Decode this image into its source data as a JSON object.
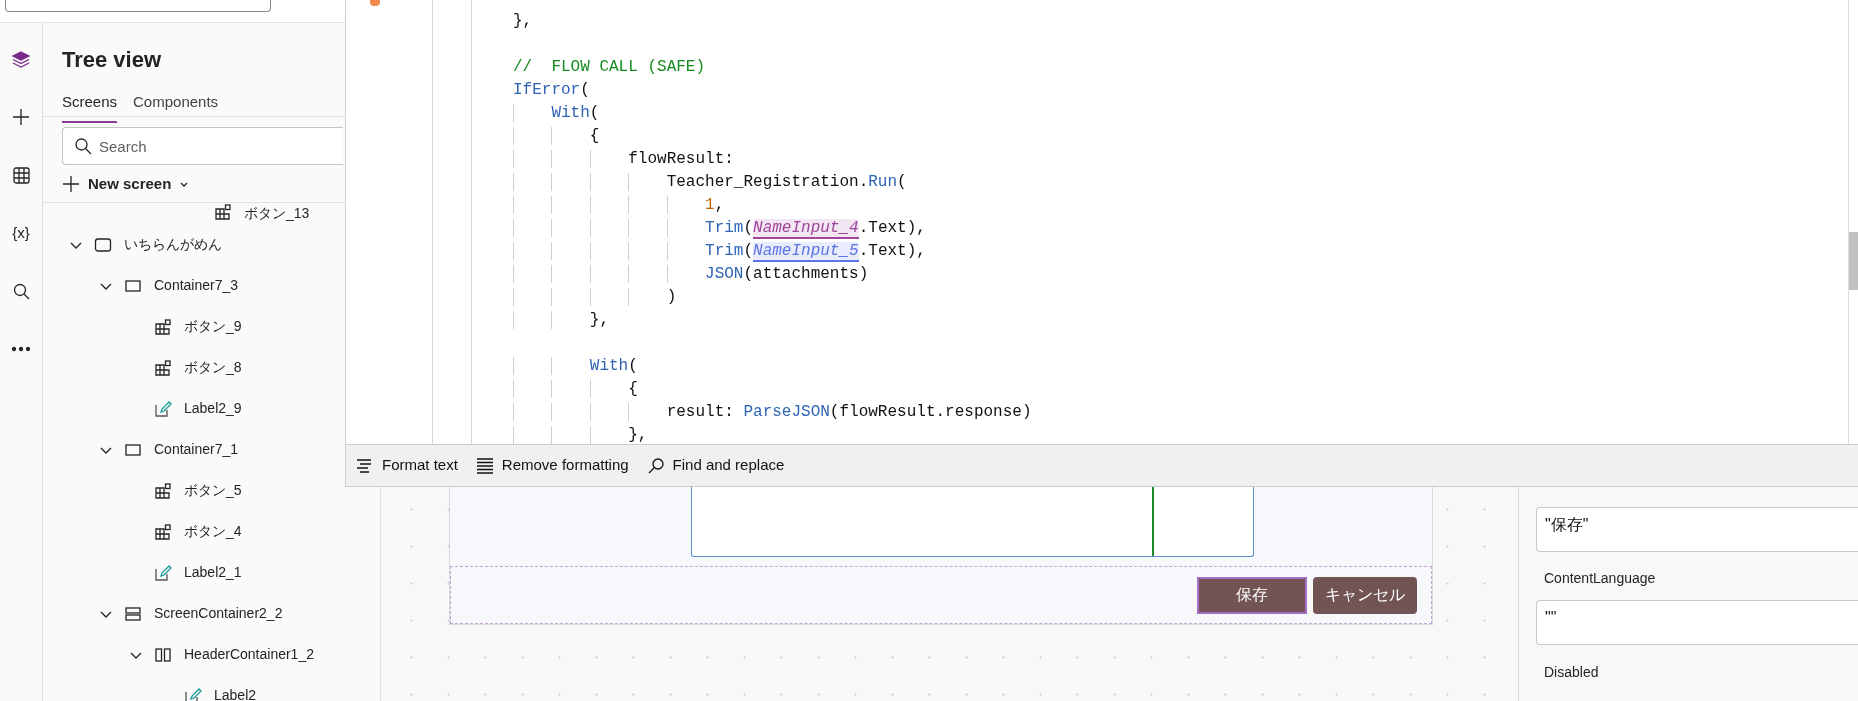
{
  "rail": [
    {
      "kind": "layers",
      "selected": true
    },
    {
      "kind": "insert",
      "selected": false
    },
    {
      "kind": "data",
      "selected": false
    },
    {
      "kind": "variables",
      "glyph": "{x}",
      "selected": false
    },
    {
      "kind": "search",
      "selected": false
    },
    {
      "kind": "more",
      "selected": false
    }
  ],
  "tree_view": {
    "title": "Tree view",
    "tabs": [
      {
        "label": "Screens",
        "selected": true
      },
      {
        "label": "Components",
        "selected": false
      }
    ],
    "search": {
      "placeholder": "Search"
    },
    "new_screen": "New screen",
    "partial_item": {
      "label": "ボタン_13",
      "kind": "button"
    },
    "items": [
      {
        "label": "いちらんがめん",
        "kind": "screen",
        "expanded": true,
        "children": [
          {
            "label": "Container7_3",
            "kind": "container",
            "expanded": true,
            "children": [
              {
                "label": "ボタン_9",
                "kind": "button"
              },
              {
                "label": "ボタン_8",
                "kind": "button"
              },
              {
                "label": "Label2_9",
                "kind": "label"
              }
            ]
          },
          {
            "label": "Container7_1",
            "kind": "container",
            "expanded": true,
            "children": [
              {
                "label": "ボタン_5",
                "kind": "button"
              },
              {
                "label": "ボタン_4",
                "kind": "button"
              },
              {
                "label": "Label2_1",
                "kind": "label"
              }
            ]
          },
          {
            "label": "ScreenContainer2_2",
            "kind": "vertical-container",
            "expanded": true,
            "children": [
              {
                "label": "HeaderContainer1_2",
                "kind": "horizontal-container",
                "expanded": true,
                "children": [
                  {
                    "label": "Label2",
                    "kind": "label"
                  }
                ]
              }
            ]
          }
        ]
      }
    ]
  },
  "formula_editor": {
    "code_lines": [
      {
        "tokens": [
          {
            "text": "},",
            "kind": "plain"
          }
        ]
      },
      {
        "kind": "blank"
      },
      {
        "tokens": [
          {
            "text": "//  FLOW CALL (SAFE)",
            "kind": "comment"
          }
        ]
      },
      {
        "tokens": [
          {
            "text": "IfError",
            "kind": "function"
          },
          {
            "text": "(",
            "kind": "plain"
          }
        ]
      },
      {
        "tokens": [
          {
            "text": "    With",
            "kind": "function"
          },
          {
            "text": "(",
            "kind": "plain"
          }
        ]
      },
      {
        "tokens": [
          {
            "text": "        {",
            "kind": "plain"
          }
        ]
      },
      {
        "tokens": [
          {
            "text": "            flowResult:",
            "kind": "plain"
          }
        ]
      },
      {
        "tokens": [
          {
            "text": "                Teacher_Registration.",
            "kind": "plain"
          },
          {
            "text": "Run",
            "kind": "function"
          },
          {
            "text": "(",
            "kind": "plain"
          }
        ]
      },
      {
        "tokens": [
          {
            "text": "                    1",
            "kind": "number"
          },
          {
            "text": ",",
            "kind": "plain"
          }
        ]
      },
      {
        "tokens": [
          {
            "text": "                    Trim",
            "kind": "function"
          },
          {
            "text": "(",
            "kind": "plain"
          },
          {
            "text": "NameInput_4",
            "kind": "reference",
            "color": "#a0449c"
          },
          {
            "text": ".Text),",
            "kind": "plain"
          }
        ]
      },
      {
        "tokens": [
          {
            "text": "                    Trim",
            "kind": "function"
          },
          {
            "text": "(",
            "kind": "plain"
          },
          {
            "text": "NameInput_5",
            "kind": "reference",
            "color": "#5b74e6"
          },
          {
            "text": ".Text),",
            "kind": "plain"
          }
        ]
      },
      {
        "tokens": [
          {
            "text": "                    JSON",
            "kind": "function"
          },
          {
            "text": "(attachments)",
            "kind": "plain"
          }
        ]
      },
      {
        "tokens": [
          {
            "text": "                )",
            "kind": "plain"
          }
        ]
      },
      {
        "tokens": [
          {
            "text": "        },",
            "kind": "plain"
          }
        ]
      },
      {
        "kind": "blank"
      },
      {
        "tokens": [
          {
            "text": "        With",
            "kind": "function"
          },
          {
            "text": "(",
            "kind": "plain"
          }
        ]
      },
      {
        "tokens": [
          {
            "text": "            {",
            "kind": "plain"
          }
        ]
      },
      {
        "tokens": [
          {
            "text": "                result: ",
            "kind": "plain"
          },
          {
            "text": "ParseJSON",
            "kind": "function"
          },
          {
            "text": "(flowResult.response)",
            "kind": "plain"
          }
        ]
      },
      {
        "tokens": [
          {
            "text": "            },",
            "kind": "plain"
          }
        ]
      }
    ],
    "toolbar": [
      {
        "label": "Format text",
        "kind": "format"
      },
      {
        "label": "Remove formatting",
        "kind": "remove-format"
      },
      {
        "label": "Find and replace",
        "kind": "find"
      }
    ]
  },
  "canvas": {
    "buttons": [
      {
        "label": "保存",
        "selected": true
      },
      {
        "label": "キャンセル",
        "selected": false
      }
    ]
  },
  "properties": [
    {
      "kind": "field",
      "value": "\"保存\""
    },
    {
      "kind": "label",
      "text": "ContentLanguage"
    },
    {
      "kind": "field",
      "value": "\"\""
    },
    {
      "kind": "label",
      "text": "Disabled"
    }
  ]
}
